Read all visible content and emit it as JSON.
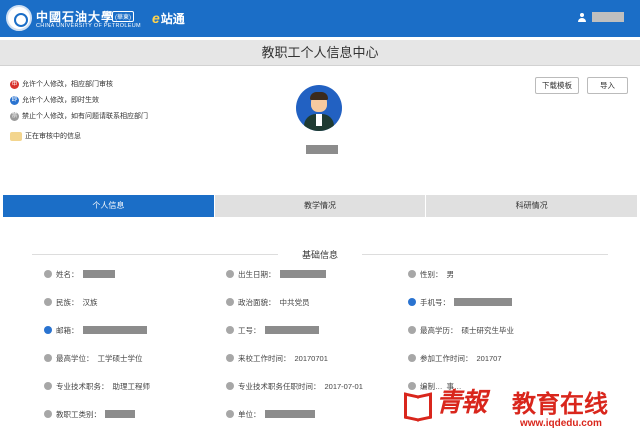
{
  "header": {
    "school_cn": "中國石油大學",
    "school_sub": "(華東)",
    "school_en": "CHINA UNIVERSITY OF PETROLEUM",
    "station_e": "e",
    "station_label": "站通",
    "user_icon": "user-icon",
    "brand_color": "#1b6ec7"
  },
  "page_title": "教职工个人信息中心",
  "legend": [
    {
      "icon": "red-badge-icon",
      "label": "允许个人修改，相应部门审核"
    },
    {
      "icon": "blue-badge-icon",
      "label": "允许个人修改，即时生效"
    },
    {
      "icon": "gray-badge-icon",
      "label": "禁止个人修改，如有问题请联系相应部门"
    },
    {
      "icon": "pending-icon",
      "label": "正在审核中的信息"
    }
  ],
  "buttons": {
    "download_template": "下载模板",
    "import": "导入"
  },
  "tabs": [
    {
      "label": "个人信息",
      "active": true
    },
    {
      "label": "教学情况",
      "active": false
    },
    {
      "label": "科研情况",
      "active": false
    }
  ],
  "section": {
    "title": "基础信息"
  },
  "fields": {
    "name": {
      "label": "姓名：",
      "value": ""
    },
    "birth_date": {
      "label": "出生日期：",
      "value": ""
    },
    "gender": {
      "label": "性别：",
      "value": "男"
    },
    "ethnicity": {
      "label": "民族：",
      "value": "汉族"
    },
    "political_status": {
      "label": "政治面貌：",
      "value": "中共党员"
    },
    "phone": {
      "label": "手机号：",
      "value": ""
    },
    "email": {
      "label": "邮箱：",
      "value": ""
    },
    "staff_id": {
      "label": "工号：",
      "value": ""
    },
    "highest_education": {
      "label": "最高学历：",
      "value": "硕士研究生毕业"
    },
    "highest_degree": {
      "label": "最高学位：",
      "value": "工学硕士学位"
    },
    "start_date_school": {
      "label": "来校工作时间：",
      "value": "20170701"
    },
    "start_date_work": {
      "label": "参加工作时间：",
      "value": "201707"
    },
    "professional_title": {
      "label": "专业技术职务：",
      "value": "助理工程师"
    },
    "title_appointment_date": {
      "label": "专业技术职务任职时间：",
      "value": "2017-07-01"
    },
    "staffing_status": {
      "label": "编制…",
      "value": "事…"
    },
    "staff_category": {
      "label": "教职工类别：",
      "value": ""
    },
    "unit": {
      "label": "单位：",
      "value": ""
    }
  },
  "watermark": {
    "brand": "青報",
    "name": "教育在线",
    "url": "www.iqdedu.com"
  }
}
